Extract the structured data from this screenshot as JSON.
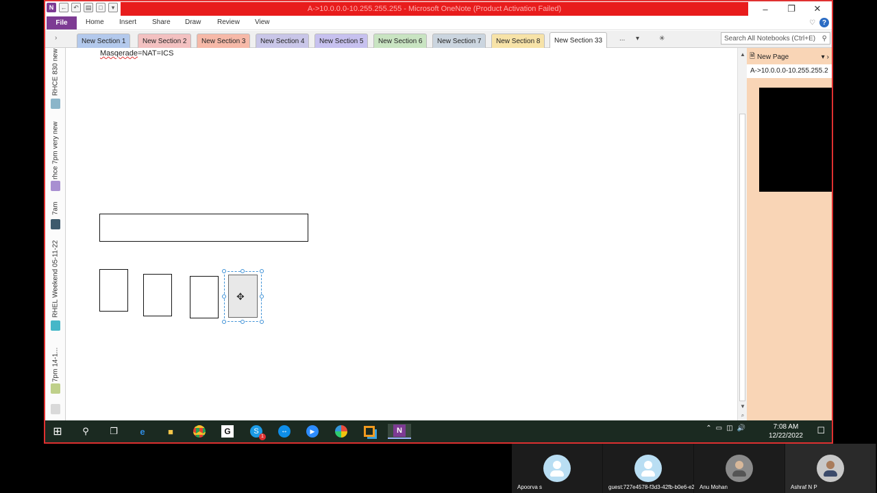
{
  "window": {
    "title": "A->10.0.0.0-10.255.255.255 - Microsoft OneNote (Product Activation Failed)"
  },
  "ribbon": {
    "file_label": "File",
    "tabs": [
      "Home",
      "Insert",
      "Share",
      "Draw",
      "Review",
      "View"
    ]
  },
  "sections": {
    "tabs": [
      {
        "label": "New Section 1",
        "color": "#b3c9ec"
      },
      {
        "label": "New Section 2",
        "color": "#f3c1c1"
      },
      {
        "label": "New Section 3",
        "color": "#f6b9a8"
      },
      {
        "label": "New Section 4",
        "color": "#c9c6e8"
      },
      {
        "label": "New Section 5",
        "color": "#c7c1ef"
      },
      {
        "label": "New Section 6",
        "color": "#c9e4c2"
      },
      {
        "label": "New Section 7",
        "color": "#cbd5df"
      },
      {
        "label": "New Section 8",
        "color": "#f7e3a8"
      },
      {
        "label": "New Section 33",
        "color": "#ffffff"
      }
    ],
    "more_label": "...",
    "search_placeholder": "Search All Notebooks (Ctrl+E)"
  },
  "notebooks": [
    {
      "label": "RHCE 830 new",
      "color": "#8bb5c9"
    },
    {
      "label": "rhce 7pm very new",
      "color": "#a88fd1"
    },
    {
      "label": "7am",
      "color": "#3d5a6c"
    },
    {
      "label": "RHEL Weekend 05-11-22",
      "color": "#45b7c8"
    },
    {
      "label": "7pm 14-1...",
      "color": "#bfd08a"
    }
  ],
  "page": {
    "note_text_underlined": "Masqerade",
    "note_text_rest": "=NAT=ICS"
  },
  "pagepane": {
    "new_page_label": "New Page",
    "pages": [
      "A->10.0.0.0-10.255.255.2"
    ]
  },
  "taskbar": {
    "time": "7:08 AM",
    "date": "12/22/2022",
    "skype_badge": "1"
  },
  "participants": [
    {
      "name": "Apoorva s",
      "type": "default"
    },
    {
      "name": "guest:727e4578-f3d3-42fb-b0e6-e2...",
      "type": "default"
    },
    {
      "name": "Anu Mohan",
      "type": "photo"
    },
    {
      "name": "Ashraf N P",
      "type": "photo"
    }
  ]
}
